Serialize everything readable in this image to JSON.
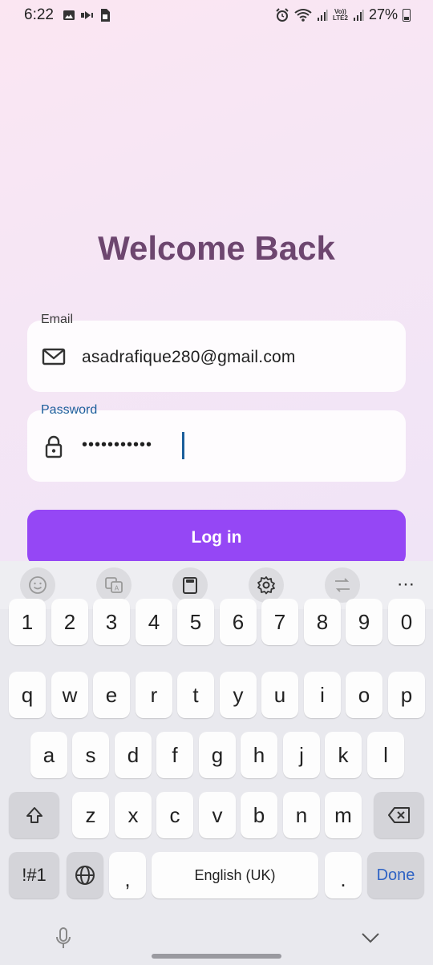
{
  "status": {
    "time": "6:22",
    "battery": "27%",
    "volte_top": "Vo))",
    "volte_bottom": "LTE2"
  },
  "screen": {
    "title": "Welcome Back",
    "email_label": "Email",
    "email_value": "asadrafique280@gmail.com",
    "password_label": "Password",
    "password_value": "•••••••••••",
    "login_label": "Log in"
  },
  "colors": {
    "accent": "#9547f5",
    "title": "#6d466f",
    "focus": "#1b5e9b"
  },
  "keyboard": {
    "toolbar_icons": [
      "emoji-icon",
      "translate-icon",
      "clipboard-icon",
      "settings-icon",
      "text-swap-icon"
    ],
    "more": "⋯",
    "row_numbers": [
      "1",
      "2",
      "3",
      "4",
      "5",
      "6",
      "7",
      "8",
      "9",
      "0"
    ],
    "row1": [
      "q",
      "w",
      "e",
      "r",
      "t",
      "y",
      "u",
      "i",
      "o",
      "p"
    ],
    "row2": [
      "a",
      "s",
      "d",
      "f",
      "g",
      "h",
      "j",
      "k",
      "l"
    ],
    "row3": [
      "z",
      "x",
      "c",
      "v",
      "b",
      "n",
      "m"
    ],
    "symbols": "!#1",
    "comma": ",",
    "space": "English (UK)",
    "period": ".",
    "done": "Done"
  }
}
